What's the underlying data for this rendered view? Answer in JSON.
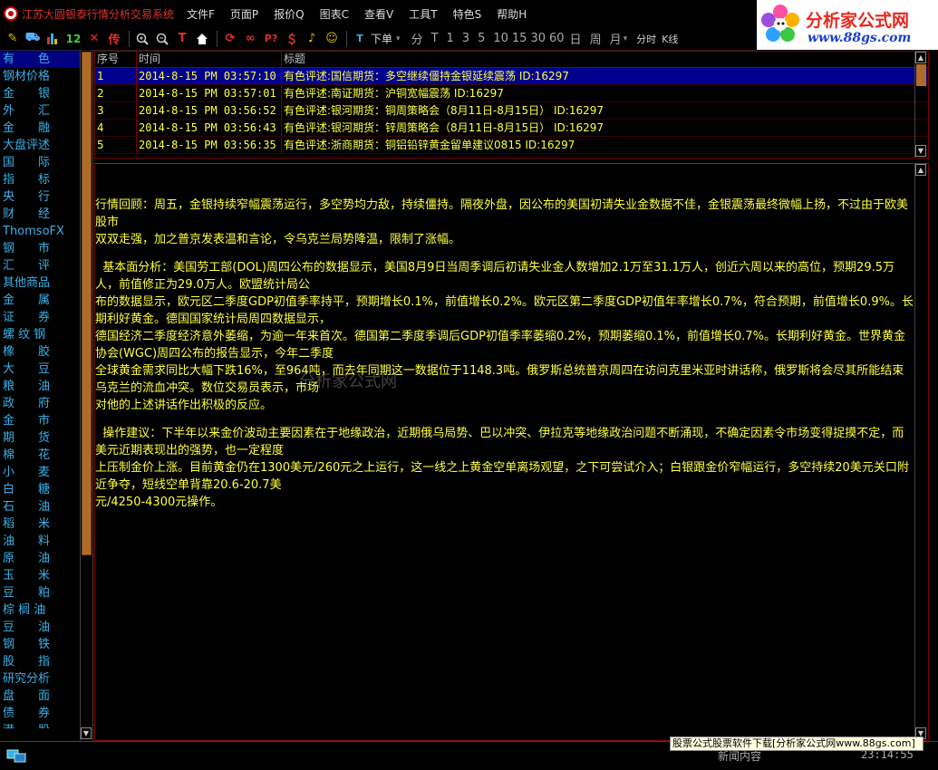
{
  "app": {
    "title": "江苏大圆银泰行情分析交易系统",
    "menus": [
      "文件F",
      "页面P",
      "报价Q",
      "图表C",
      "查看V",
      "工具T",
      "特色S",
      "帮助H"
    ]
  },
  "logo": {
    "text": "分析家公式网",
    "url": "www.88gs.com"
  },
  "toolbar": {
    "order_label": "下单",
    "periods": [
      "分",
      "T",
      "1",
      "3",
      "5",
      "10",
      "15",
      "30",
      "60",
      "日",
      "周",
      "月"
    ],
    "timeshare_label": "分时",
    "kline_label": "K线",
    "number_12": "12",
    "chuan_label": "传"
  },
  "sidebar": {
    "items": [
      "有　　色",
      "钢材价格",
      "金　　银",
      "外　　汇",
      "金　　融",
      "大盘评述",
      "国　　际",
      "指　　标",
      "央　　行",
      "财　　经",
      "ThomsoFX",
      "钢　　市",
      "汇　　评",
      "其他商品",
      "金　　属",
      "证　　券",
      "螺 纹 钢",
      "橡　　胶",
      "大　　豆",
      "粮　　油",
      "政　　府",
      "金　　市",
      "期　　货",
      "棉　　花",
      "小　　麦",
      "白　　糖",
      "石　　油",
      "稻　　米",
      "油　　料",
      "原　　油",
      "玉　　米",
      "豆　　粕",
      "棕 榈 油",
      "豆　　油",
      "钢　　铁",
      "股　　指",
      "研究分析",
      "盘　　面",
      "债　　券",
      "港　　股"
    ]
  },
  "news": {
    "headers": {
      "no": "序号",
      "time": "时间",
      "title": "标题"
    },
    "rows": [
      {
        "no": "1",
        "time": "2014-8-15 PM 03:57:10",
        "title": "有色评述:国信期货：多空继续僵持金银延续震荡  ID:16297"
      },
      {
        "no": "2",
        "time": "2014-8-15 PM 03:57:01",
        "title": "有色评述:南证期货：沪铜宽幅震荡  ID:16297"
      },
      {
        "no": "3",
        "time": "2014-8-15 PM 03:56:52",
        "title": "有色评述:银河期货：铜周策略会（8月11日-8月15日）  ID:16297"
      },
      {
        "no": "4",
        "time": "2014-8-15 PM 03:56:43",
        "title": "有色评述:银河期货：锌周策略会（8月11日-8月15日）  ID:16297"
      },
      {
        "no": "5",
        "time": "2014-8-15 PM 03:56:35",
        "title": "有色评述:浙商期货：铜铝铅锌黄金留单建议0815  ID:16297"
      }
    ]
  },
  "article": {
    "paragraphs": [
      "行情回顾：周五，金银持续窄幅震荡运行，多空势均力敌，持续僵持。隔夜外盘，因公布的美国初请失业金数据不佳，金银震荡最终微幅上扬，不过由于欧美股市\n双双走强，加之普京发表温和言论，令乌克兰局势降温，限制了涨幅。",
      "  基本面分析：美国劳工部(DOL)周四公布的数据显示，美国8月9日当周季调后初请失业金人数增加2.1万至31.1万人，创近六周以来的高位，预期29.5万人，前值修正为29.0万人。欧盟统计局公\n布的数据显示，欧元区二季度GDP初值季率持平，预期增长0.1%，前值增长0.2%。欧元区第二季度GDP初值年率增长0.7%，符合预期，前值增长0.9%。长期利好黄金。德国国家统计局周四数据显示，\n德国经济二季度经济意外萎缩，为逾一年来首次。德国第二季度季调后GDP初值季率萎缩0.2%，预期萎缩0.1%，前值增长0.7%。长期利好黄金。世界黄金协会(WGC)周四公布的报告显示，今年二季度\n全球黄金需求同比大幅下跌16%，至964吨，而去年同期这一数据位于1148.3吨。俄罗斯总统普京周四在访问克里米亚时讲话称，俄罗斯将会尽其所能结束乌克兰的流血冲突。数位交易员表示，市场\n对他的上述讲话作出积极的反应。",
      "  操作建议：下半年以来金价波动主要因素在于地缘政治，近期俄乌局势、巴以冲突、伊拉克等地缘政治问题不断涌现，不确定因素令市场变得捉摸不定，而美元近期表现出的强势，也一定程度\n上压制金价上涨。目前黄金仍在1300美元/260元之上运行，这一线之上黄金空单离场观望，之下可尝试介入；白银跟金价窄幅运行，多空持续20美元关口附近争夺，短线空单背靠20.6-20.7美\n元/4250-4300元操作。"
    ]
  },
  "watermark": "分析家公式网",
  "status": {
    "channel": "新闻内容",
    "clock": "23:14:55",
    "ad": "股票公式股票软件下载[分析家公式网www.88gs.com]"
  }
}
